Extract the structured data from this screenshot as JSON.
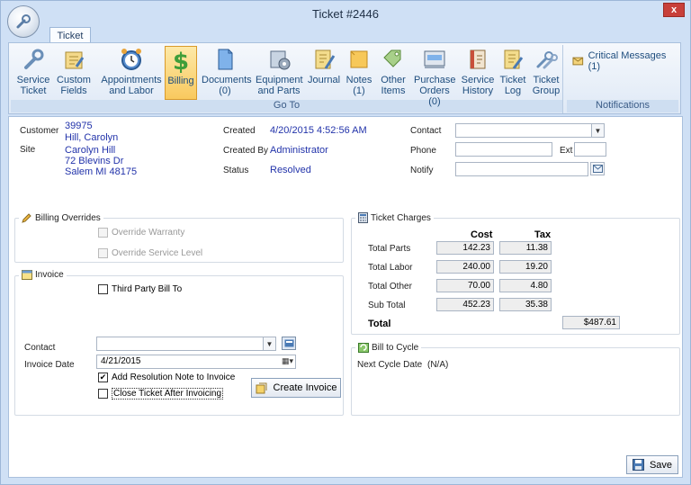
{
  "window": {
    "title": "Ticket #2446",
    "close_label": "x"
  },
  "ribbon": {
    "tab": "Ticket",
    "groups": [
      {
        "label": "Go To"
      },
      {
        "label": "Notifications"
      }
    ],
    "buttons": [
      {
        "label1": "Service",
        "label2": "Ticket"
      },
      {
        "label1": "Custom",
        "label2": "Fields"
      },
      {
        "label1": "Appointments",
        "label2": "and Labor"
      },
      {
        "label1": "Billing",
        "label2": ""
      },
      {
        "label1": "Documents",
        "label2": "(0)"
      },
      {
        "label1": "Equipment",
        "label2": "and Parts"
      },
      {
        "label1": "Journal",
        "label2": ""
      },
      {
        "label1": "Notes",
        "label2": "(1)"
      },
      {
        "label1": "Other",
        "label2": "Items"
      },
      {
        "label1": "Purchase",
        "label2": "Orders (0)"
      },
      {
        "label1": "Service",
        "label2": "History"
      },
      {
        "label1": "Ticket",
        "label2": "Log"
      },
      {
        "label1": "Ticket",
        "label2": "Group"
      }
    ],
    "critical_messages": "Critical Messages (1)"
  },
  "info": {
    "customer_label": "Customer",
    "customer_id": "39975",
    "customer_name": "Hill, Carolyn",
    "site_label": "Site",
    "site_name": "Carolyn Hill",
    "site_street": "72 Blevins Dr",
    "site_city": "Salem MI 48175",
    "created_label": "Created",
    "created_value": "4/20/2015 4:52:56 AM",
    "created_by_label": "Created By",
    "created_by_value": "Administrator",
    "status_label": "Status",
    "status_value": "Resolved",
    "contact_label": "Contact",
    "contact_value": "",
    "phone_label": "Phone",
    "phone_value": "",
    "ext_label": "Ext",
    "ext_value": "",
    "notify_label": "Notify",
    "notify_value": ""
  },
  "billing_overrides": {
    "title": "Billing Overrides",
    "override_warranty": "Override Warranty",
    "override_service_level": "Override Service Level"
  },
  "invoice": {
    "title": "Invoice",
    "third_party": "Third Party Bill To",
    "contact_label": "Contact",
    "contact_value": "",
    "date_label": "Invoice Date",
    "date_value": "4/21/2015",
    "add_note": "Add Resolution Note to Invoice",
    "close_ticket": "Close Ticket After Invoicing",
    "create_button": "Create Invoice"
  },
  "charges": {
    "title": "Ticket Charges",
    "cost_header": "Cost",
    "tax_header": "Tax",
    "rows": [
      {
        "label": "Total Parts",
        "cost": "142.23",
        "tax": "11.38"
      },
      {
        "label": "Total Labor",
        "cost": "240.00",
        "tax": "19.20"
      },
      {
        "label": "Total Other",
        "cost": "70.00",
        "tax": "4.80"
      },
      {
        "label": "Sub Total",
        "cost": "452.23",
        "tax": "35.38"
      }
    ],
    "total_label": "Total",
    "total_value": "$487.61"
  },
  "bill_to_cycle": {
    "title": "Bill to Cycle",
    "next_label": "Next Cycle Date",
    "next_value": "(N/A)"
  },
  "footer": {
    "save_label": "Save"
  }
}
